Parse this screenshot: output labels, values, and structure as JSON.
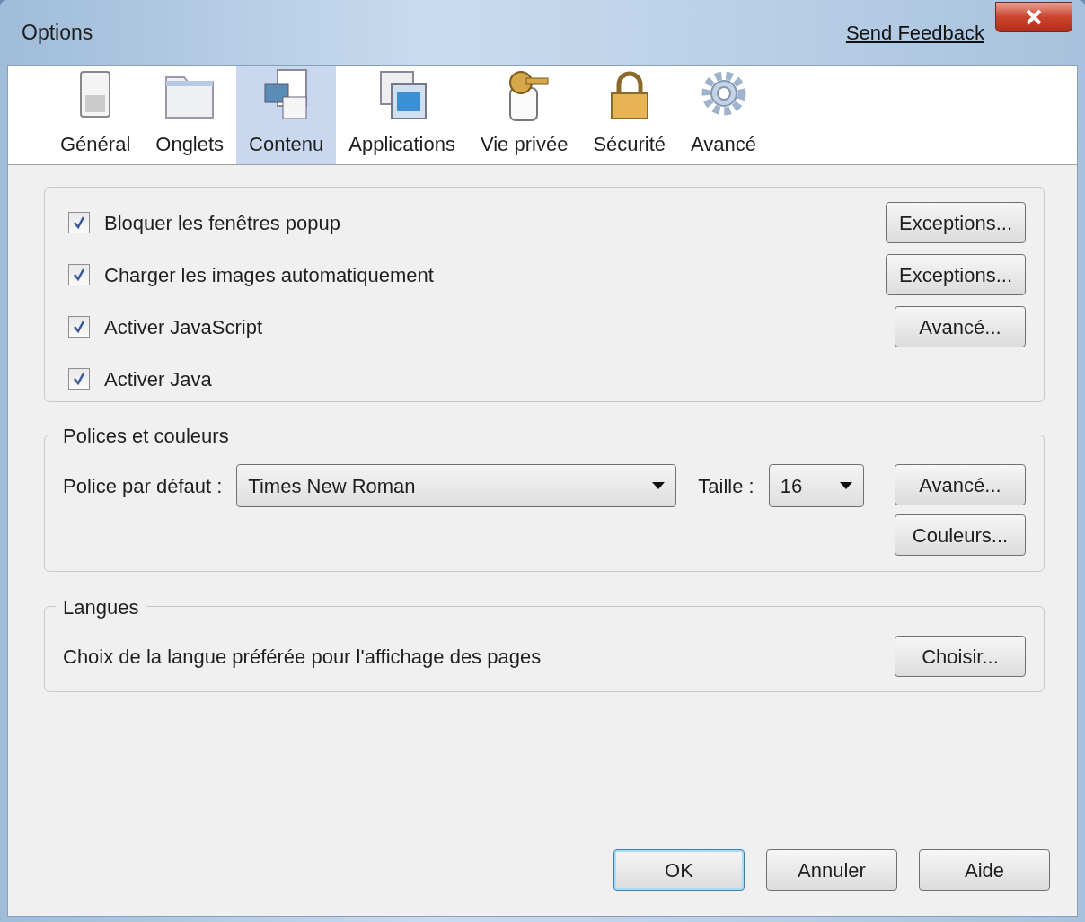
{
  "window": {
    "title": "Options",
    "feedback_link": "Send Feedback"
  },
  "tabs": [
    {
      "label": "Général",
      "kind": "switch",
      "selected": false
    },
    {
      "label": "Onglets",
      "kind": "folder",
      "selected": false
    },
    {
      "label": "Contenu",
      "kind": "page",
      "selected": true
    },
    {
      "label": "Applications",
      "kind": "apps",
      "selected": false
    },
    {
      "label": "Vie privée",
      "kind": "key",
      "selected": false
    },
    {
      "label": "Sécurité",
      "kind": "lock",
      "selected": false
    },
    {
      "label": "Avancé",
      "kind": "gear",
      "selected": false
    }
  ],
  "content_options": [
    {
      "label": "Bloquer les fenêtres popup",
      "checked": true,
      "button": {
        "label": "Exceptions..."
      }
    },
    {
      "label": "Charger les images automatiquement",
      "checked": true,
      "button": {
        "label": "Exceptions..."
      }
    },
    {
      "label": "Activer JavaScript",
      "checked": true,
      "button": {
        "label": "Avancé..."
      }
    },
    {
      "label": "Activer Java",
      "checked": true
    }
  ],
  "fonts": {
    "legend": "Polices et couleurs",
    "font_label": "Police par défaut :",
    "font_value": "Times New Roman",
    "size_label": "Taille :",
    "size_value": "16",
    "buttons": [
      {
        "label": "Avancé..."
      },
      {
        "label": "Couleurs..."
      }
    ]
  },
  "languages": {
    "legend": "Langues",
    "text": "Choix de la langue préférée pour l'affichage des pages",
    "button": {
      "label": "Choisir..."
    }
  },
  "buttons": [
    {
      "label": "OK",
      "default": true
    },
    {
      "label": "Annuler",
      "default": false
    },
    {
      "label": "Aide",
      "default": false
    }
  ]
}
